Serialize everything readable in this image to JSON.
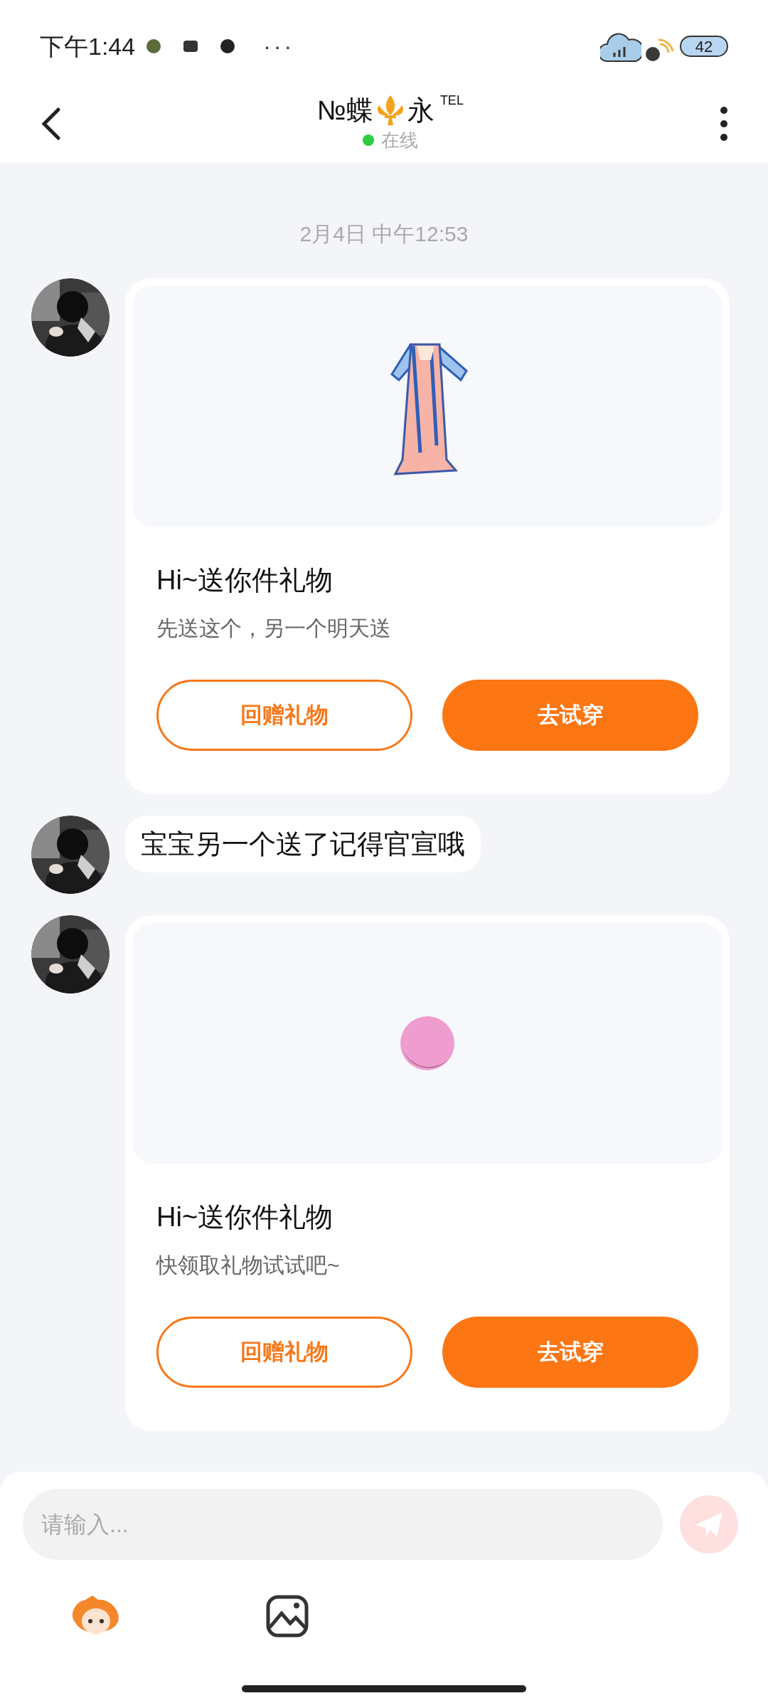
{
  "status_bar": {
    "time": "下午1:44",
    "more": "···",
    "battery": "42"
  },
  "header": {
    "name_start": "№蝶",
    "name_end": "永",
    "tag": "TEL",
    "status": "在线",
    "online": true
  },
  "date": "2月4日 中午12:53",
  "messages": [
    {
      "kind": "gift",
      "image": {
        "kind": "dress"
      },
      "title": "Hi~送你件礼物",
      "subtitle": "先送这个，另一个明天送",
      "buttons": [
        "回赠礼物",
        "去试穿"
      ]
    },
    {
      "kind": "text",
      "text": "宝宝另一个送了记得官宣哦"
    },
    {
      "kind": "gift",
      "image": {
        "kind": "ball"
      },
      "title": "Hi~送你件礼物",
      "subtitle": "快领取礼物试试吧~",
      "buttons": [
        "回赠礼物",
        "去试穿"
      ]
    }
  ],
  "composer": {
    "placeholder": "请输入..."
  }
}
